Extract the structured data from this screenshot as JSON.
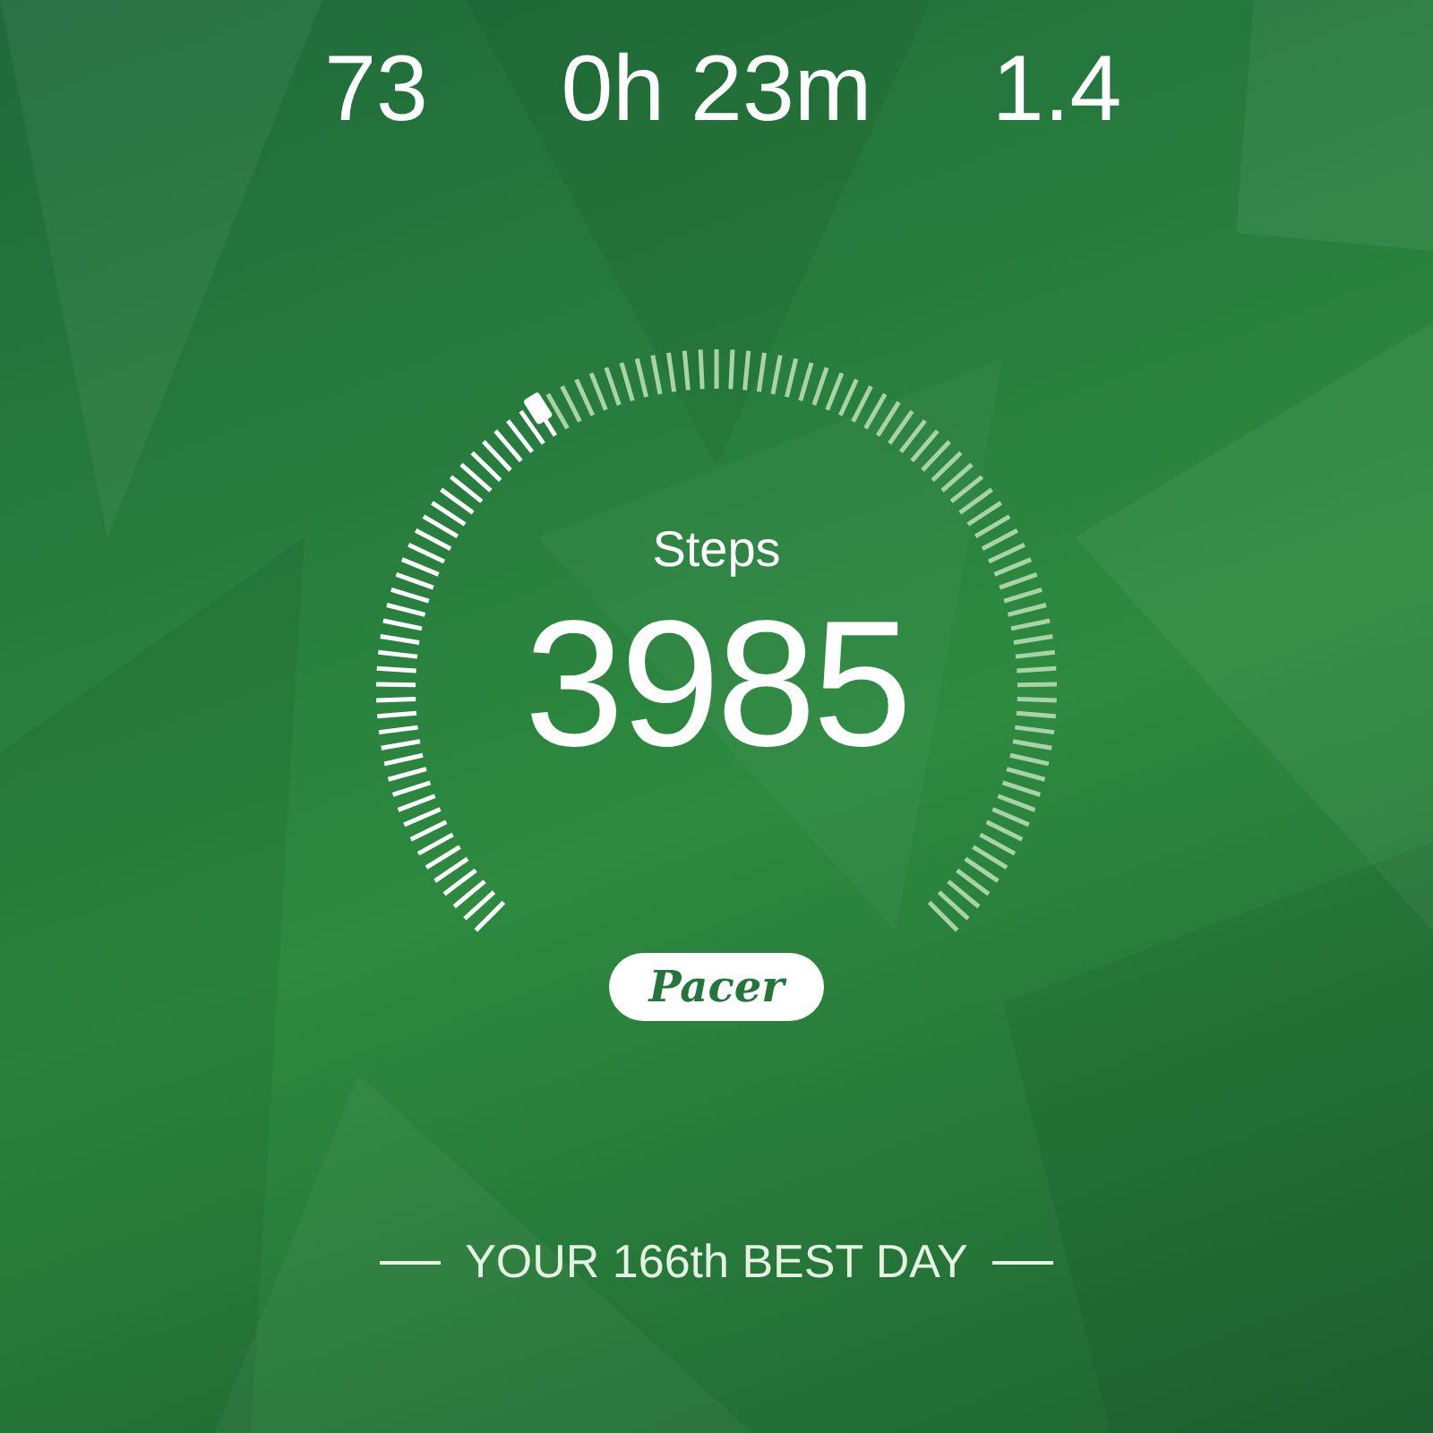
{
  "stats": [
    {
      "value": "73"
    },
    {
      "value": "0h 23m"
    },
    {
      "value": "1.4"
    }
  ],
  "gauge": {
    "label": "Steps",
    "value": "3985"
  },
  "logo": {
    "text": "Pacer"
  },
  "footer": {
    "text": "YOUR 166th BEST DAY"
  }
}
